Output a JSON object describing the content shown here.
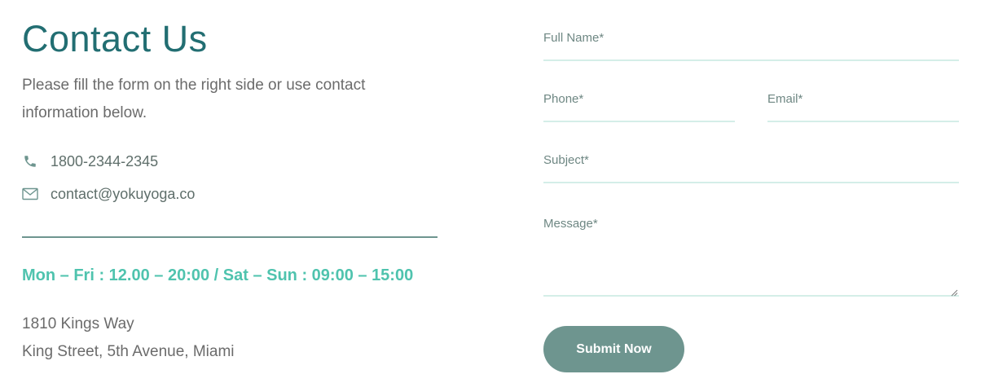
{
  "contact": {
    "title": "Contact Us",
    "intro": "Please fill the form on the right side or use contact information below.",
    "phone": {
      "icon": "phone-icon",
      "text": "1800-2344-2345"
    },
    "email": {
      "icon": "mail-icon",
      "text": "contact@yokuyoga.co"
    },
    "hours": "Mon – Fri : 12.00 – 20:00 / Sat – Sun : 09:00 – 15:00",
    "address_line1": "1810 Kings Way",
    "address_line2": "King Street, 5th Avenue, Miami"
  },
  "form": {
    "full_name_label": "Full Name*",
    "phone_label": "Phone*",
    "email_label": "Email*",
    "subject_label": "Subject*",
    "message_label": "Message*",
    "submit_label": "Submit Now"
  },
  "colors": {
    "title": "#226e72",
    "accent": "#4fc3ae",
    "button": "#6e958f",
    "field_underline": "#d4eee8"
  }
}
